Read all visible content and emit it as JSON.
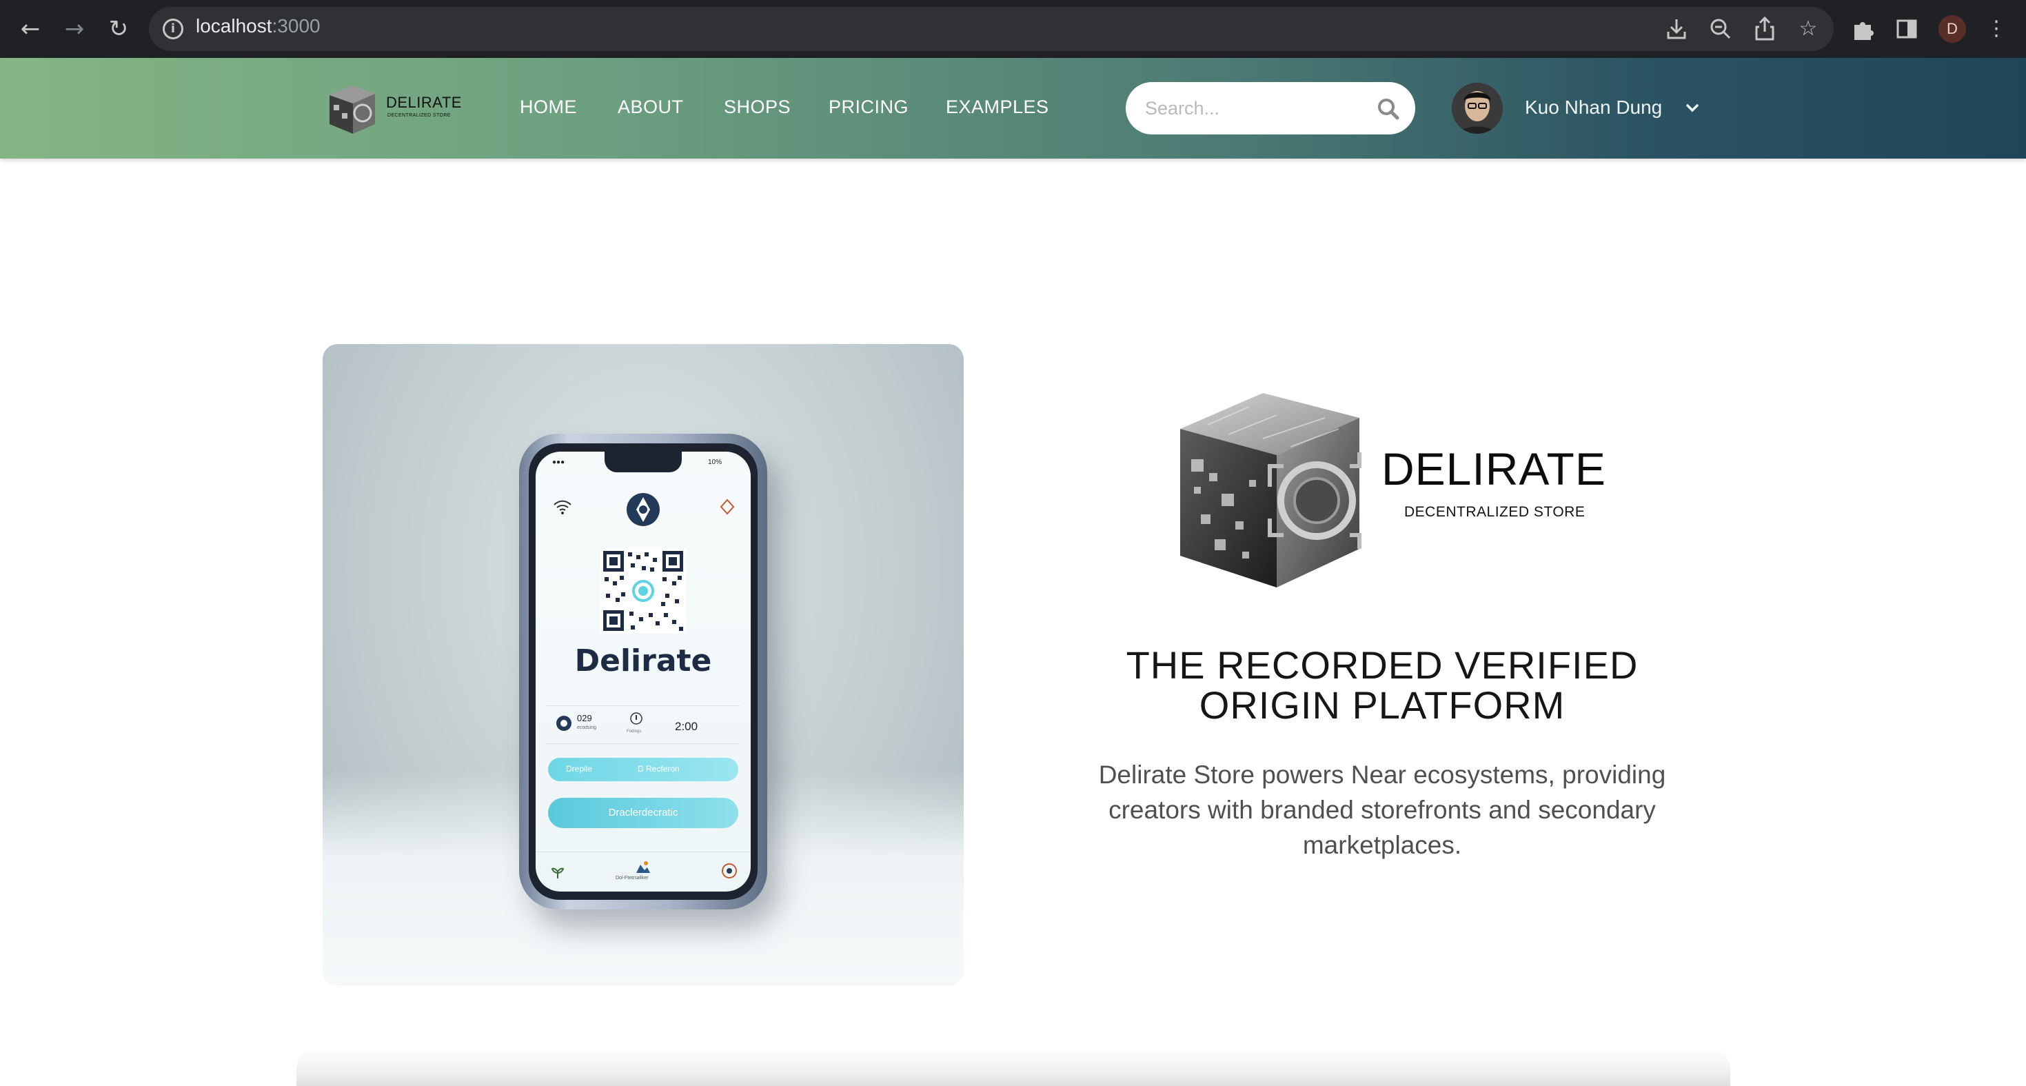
{
  "browser": {
    "url_host": "localhost",
    "url_port": ":3000",
    "profile_initial": "D"
  },
  "header": {
    "brand_name": "DELIRATE",
    "brand_sub": "DECENTRALIZED STORE",
    "nav": [
      {
        "label": "HOME"
      },
      {
        "label": "ABOUT"
      },
      {
        "label": "SHOPS"
      },
      {
        "label": "PRICING"
      },
      {
        "label": "EXAMPLES"
      }
    ],
    "search_placeholder": "Search...",
    "user_name": "Kuo Nhan Dung"
  },
  "hero": {
    "phone": {
      "title": "Delirate",
      "stat_value": "029",
      "stat_caption": "ecodsing",
      "stat_small": "Fodings",
      "time": "2:00",
      "pill_left": "Drepile",
      "pill_right": "D Recferon",
      "button": "Draclerdecratic",
      "tab_label": "Dol-Ftetrsaliker",
      "status_right": "10%"
    },
    "brand_name": "DELIRATE",
    "brand_sub": "DECENTRALIZED STORE",
    "headline_line1": "THE RECORDED VERIFIED",
    "headline_line2": "ORIGIN PLATFORM",
    "description": "Delirate Store powers Near ecosystems, providing creators with branded storefronts and secondary marketplaces."
  },
  "colors": {
    "header_start": "#84b584",
    "header_end": "#1f4657",
    "chrome_bg": "#202124"
  }
}
